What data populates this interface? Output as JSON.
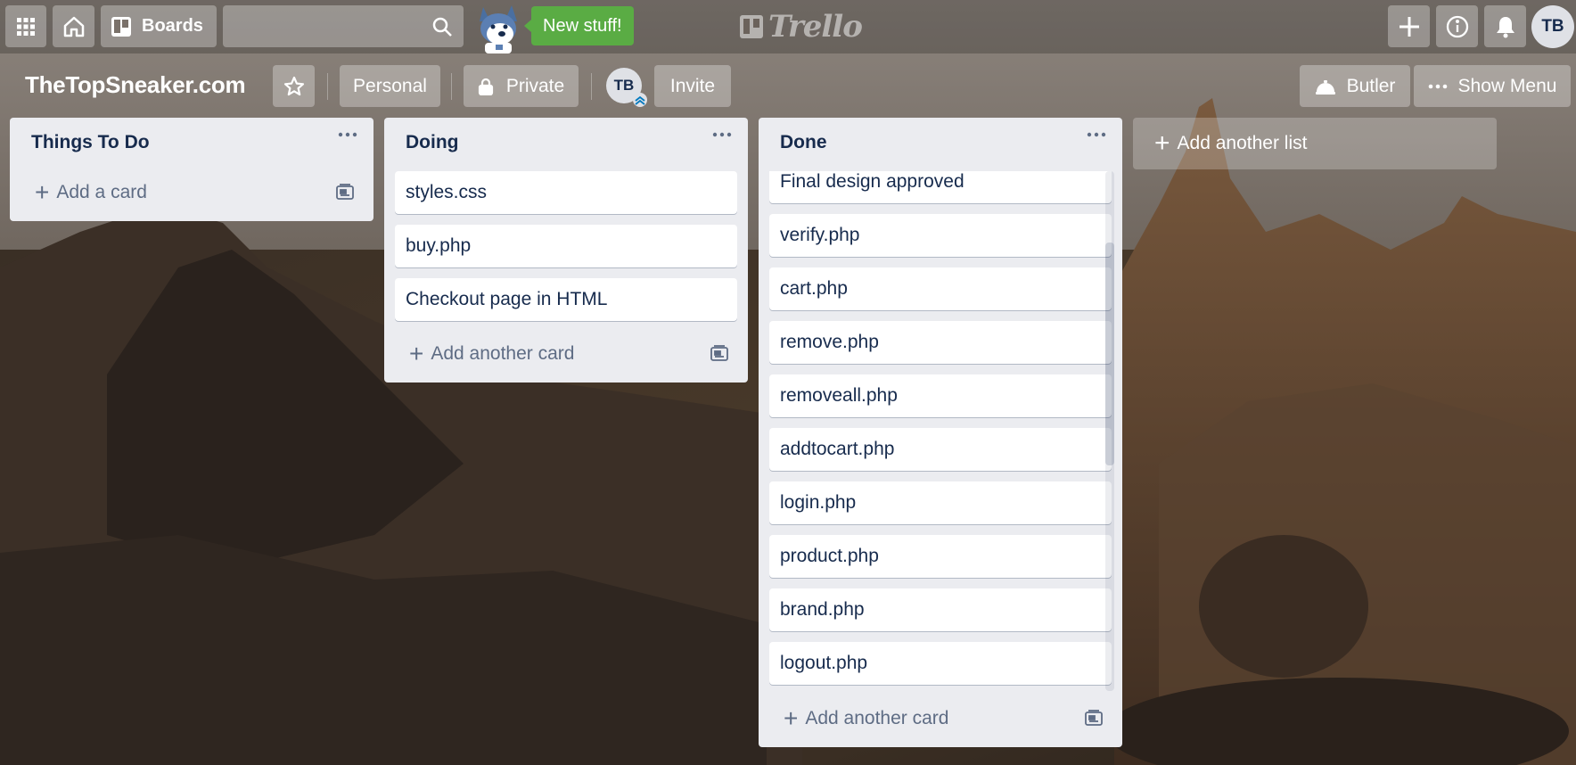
{
  "header": {
    "boards_label": "Boards",
    "new_stuff_label": "New stuff!",
    "logo_text": "Trello",
    "user_initials": "TB"
  },
  "board": {
    "title": "TheTopSneaker.com",
    "personal_label": "Personal",
    "private_label": "Private",
    "member_initials": "TB",
    "invite_label": "Invite",
    "butler_label": "Butler",
    "show_menu_label": "Show Menu"
  },
  "lists": [
    {
      "title": "Things To Do",
      "cards": [],
      "add_card_label": "Add a card"
    },
    {
      "title": "Doing",
      "cards": [
        "styles.css",
        "buy.php",
        "Checkout page in HTML"
      ],
      "add_card_label": "Add another card"
    },
    {
      "title": "Done",
      "cards": [
        "Final design approved",
        "verify.php",
        "cart.php",
        "remove.php",
        "removeall.php",
        "addtocart.php",
        "login.php",
        "product.php",
        "brand.php",
        "logout.php"
      ],
      "add_card_label": "Add another card"
    }
  ],
  "add_list_label": "Add another list",
  "colors": {
    "list_bg": "#ebecf0",
    "card_text": "#172b4d",
    "new_stuff_green": "#5aac44"
  }
}
